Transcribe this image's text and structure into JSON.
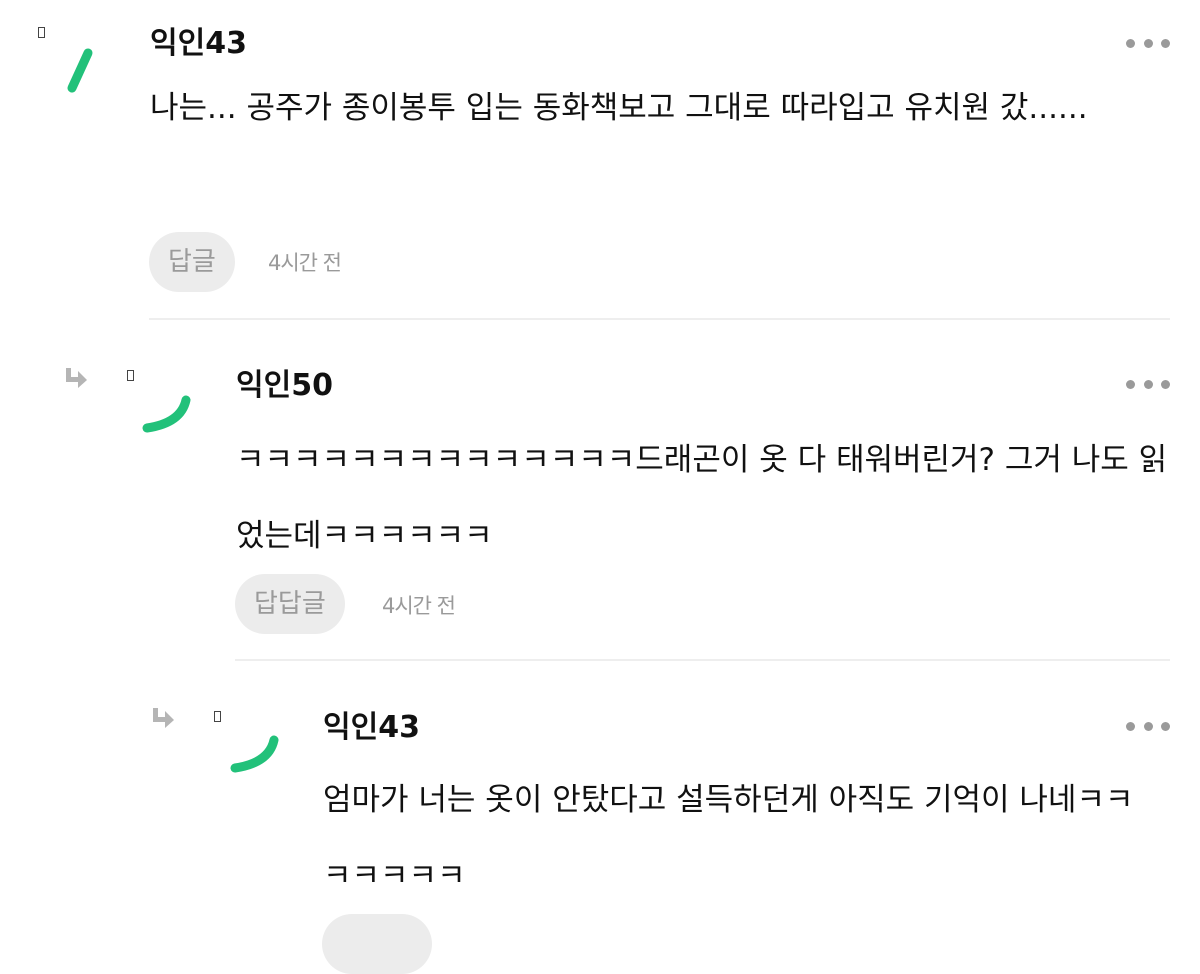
{
  "colors": {
    "accent": "#22c17a",
    "button_bg": "#ececec",
    "muted_text": "#9a9a9a",
    "divider": "#eeeeee"
  },
  "comments": [
    {
      "nickname": "익인43",
      "text": "나는... 공주가 종이봉투 입는 동화책보고 그대로 따라입고 유치원 갔......",
      "reply_label": "답글",
      "time": "4시간 전"
    },
    {
      "nickname": "익인50",
      "text": "ㅋㅋㅋㅋㅋㅋㅋㅋㅋㅋㅋㅋㅋㅋ드래곤이 옷 다 태워버린거? 그거 나도 읽었는데ㅋㅋㅋㅋㅋㅋ",
      "reply_label": "답답글",
      "time": "4시간 전"
    },
    {
      "nickname": "익인43",
      "text": "엄마가 너는 옷이 안탔다고 설득하던게 아직도 기억이 나네ㅋㅋㅋㅋㅋㅋㅋ",
      "reply_label": "",
      "time": ""
    }
  ],
  "icons": {
    "reply_arrow": "reply-arrow-icon",
    "more": "more-options-icon"
  }
}
